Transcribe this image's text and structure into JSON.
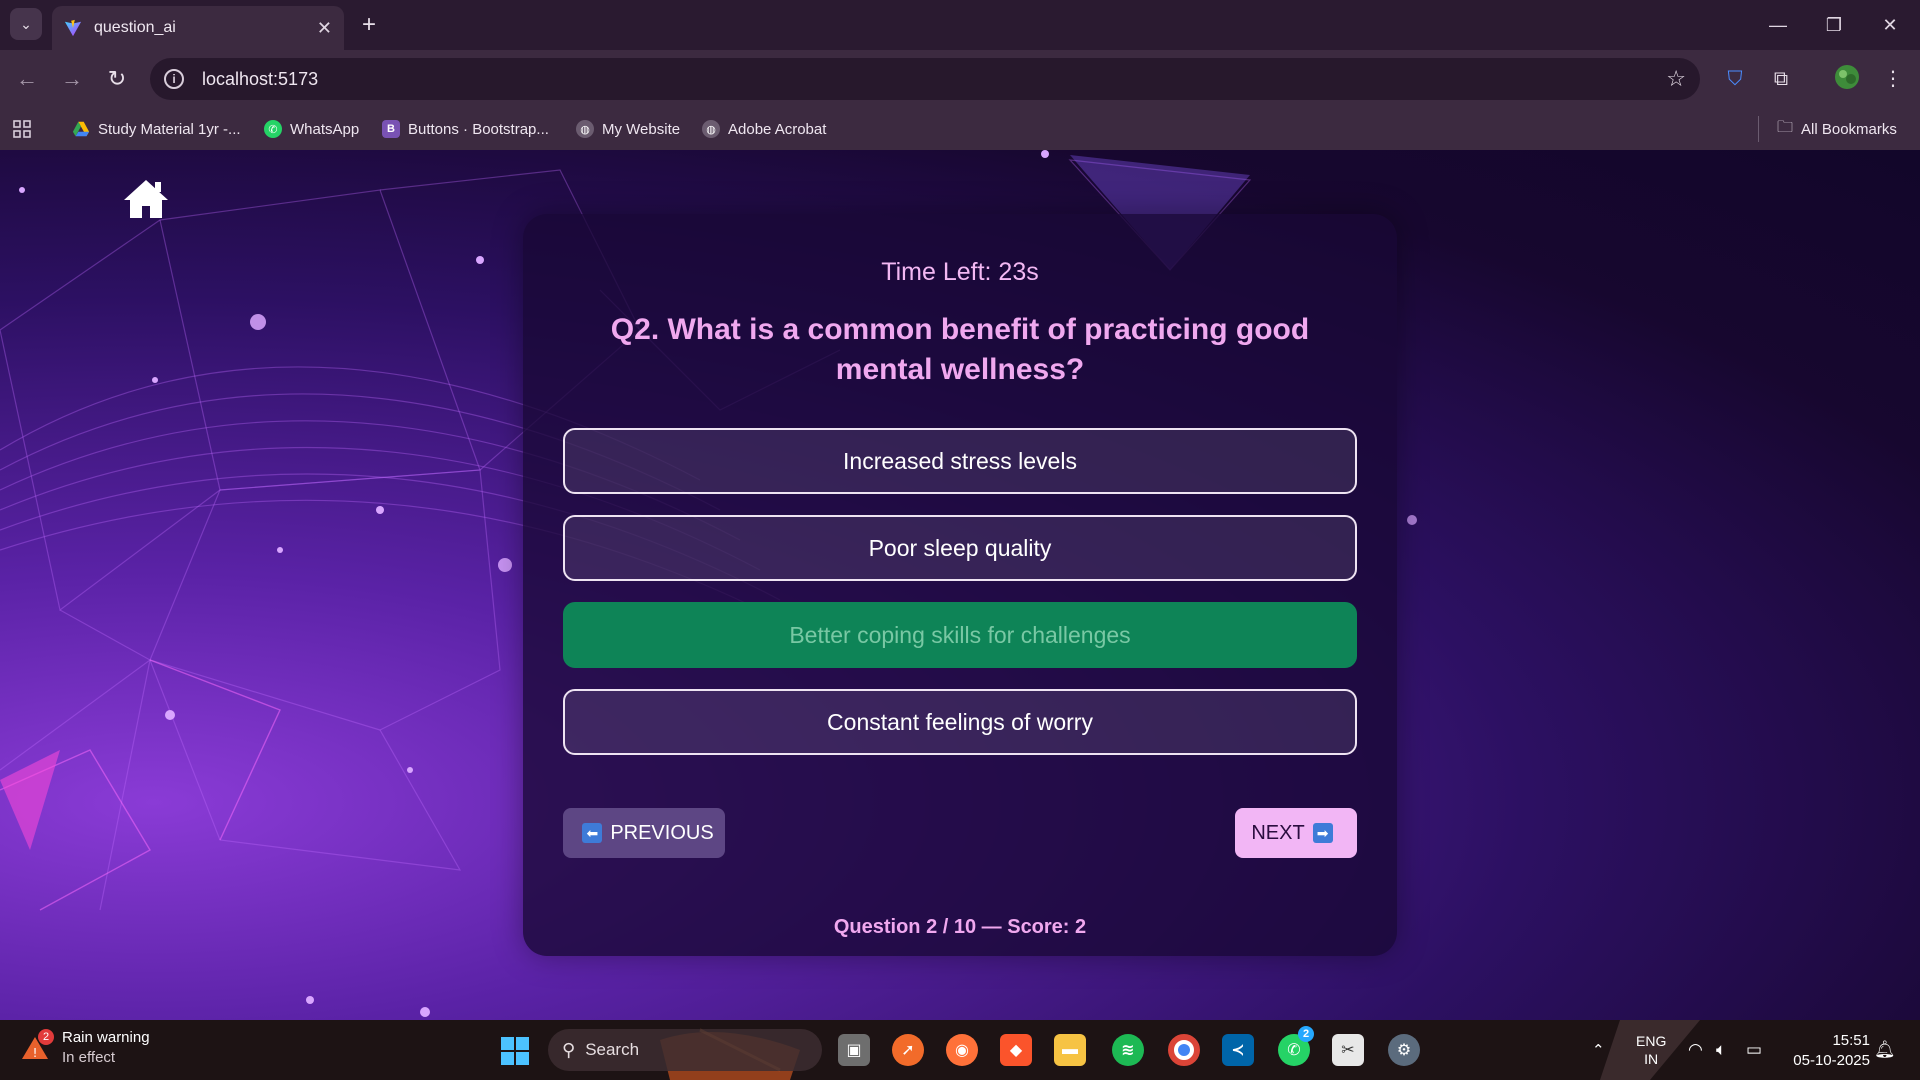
{
  "browser": {
    "tab_title": "question_ai",
    "url": "localhost:5173",
    "bookmarks": [
      {
        "label": "Study Material 1yr -..."
      },
      {
        "label": "WhatsApp"
      },
      {
        "label": "Buttons · Bootstrap..."
      },
      {
        "label": "My Website"
      },
      {
        "label": "Adobe Acrobat"
      }
    ],
    "all_bookmarks": "All Bookmarks"
  },
  "quiz": {
    "timer": "Time Left: 23s",
    "question": "Q2. What is a common benefit of practicing good mental wellness?",
    "options": [
      {
        "label": "Increased stress levels",
        "state": "default"
      },
      {
        "label": "Poor sleep quality",
        "state": "default"
      },
      {
        "label": "Better coping skills for challenges",
        "state": "correct"
      },
      {
        "label": "Constant feelings of worry",
        "state": "default"
      }
    ],
    "prev_label": "PREVIOUS",
    "next_label": "NEXT",
    "progress": "Question 2 / 10 — Score: 2"
  },
  "taskbar": {
    "weather_title": "Rain warning",
    "weather_sub": "In effect",
    "weather_badge": "2",
    "search_label": "Search",
    "whatsapp_badge": "2",
    "lang_1": "ENG",
    "lang_2": "IN",
    "time": "15:51",
    "date": "05-10-2025"
  },
  "colors": {
    "accent_pink": "#f0a8ef",
    "correct_green": "#0e8457",
    "prev_button": "#5d4684",
    "next_button": "#f2b6f5"
  }
}
